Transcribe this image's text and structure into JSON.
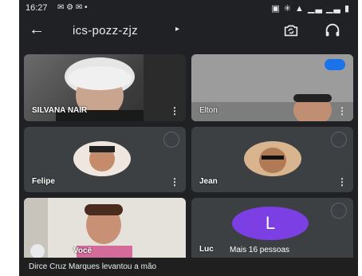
{
  "status": {
    "time": "16:27",
    "indicators": "✉ ⚙ ✉ •",
    "system": "▣ ✳ ▲ ▁▃ ▁▃ ▮"
  },
  "appbar": {
    "back": "←",
    "meeting_code": "ics-pozz-zjz",
    "caret": "▸",
    "camera_switch_icon": "camera-switch-icon",
    "audio_icon": "headphones-icon"
  },
  "participants": [
    {
      "name": "SILVANA NAIR",
      "more": "⋮",
      "muted": false
    },
    {
      "name": "Elton",
      "more": "⋮",
      "speaking": true
    },
    {
      "name": "Felipe",
      "more": "⋮",
      "muted": true
    },
    {
      "name": "Jean",
      "more": "⋮",
      "muted": true
    },
    {
      "name": "Você",
      "hand_raised": true
    },
    {
      "name": "Luc",
      "initial": "L",
      "muted": true
    }
  ],
  "overflow": {
    "label": "Mais 16 pessoas"
  },
  "toast": {
    "message": "Dirce Cruz Marques levantou a mão"
  },
  "colors": {
    "background": "#202124",
    "tile": "#3c4043",
    "accent": "#1a73e8",
    "avatar_purple": "#7b3fe4"
  }
}
